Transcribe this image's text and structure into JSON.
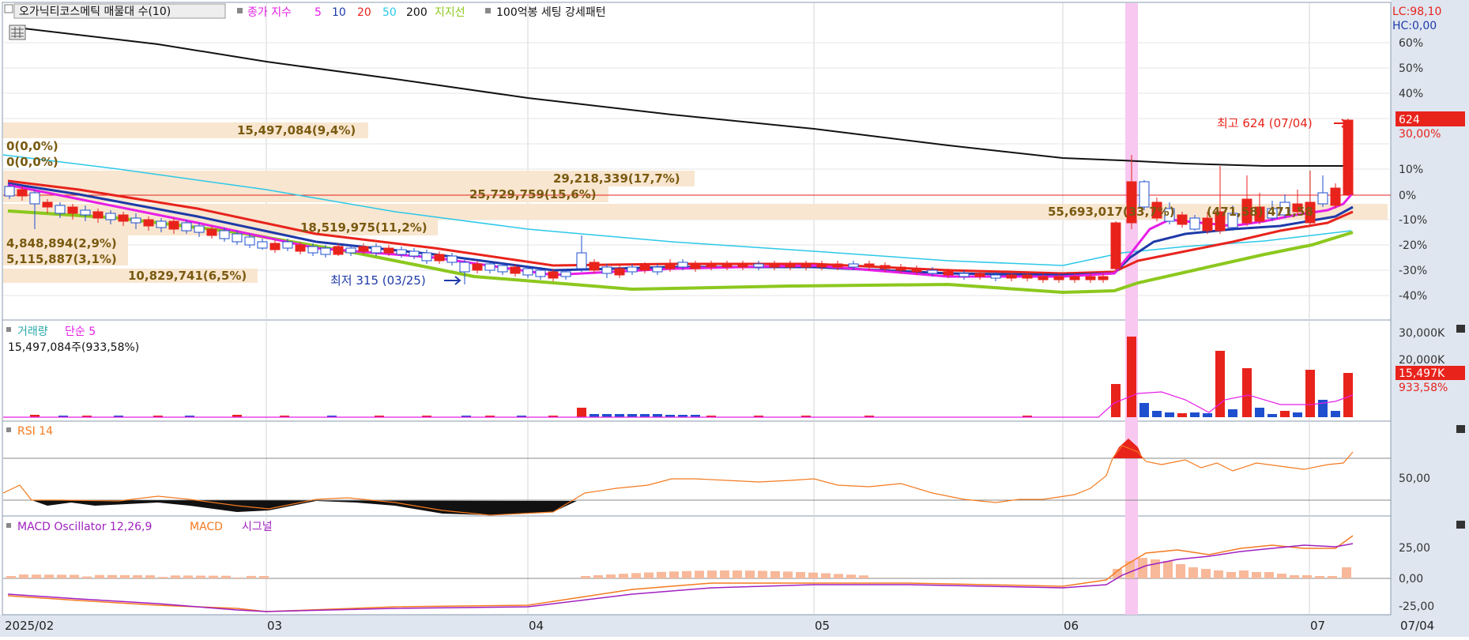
{
  "legend": {
    "title": "오가닉티코스메틱 매물대 수(10)",
    "close_ma": "종가 지수",
    "periods": [
      "5",
      "10",
      "20",
      "50",
      "200"
    ],
    "support": "지지선",
    "pattern": "100억봉 세팅 강세패턴"
  },
  "scale_info": {
    "lc": "LC:98,10",
    "hc": "HC:0,00"
  },
  "colors": {
    "bg": "#ffffff",
    "panel_right": "#dfe6f0",
    "border": "#8a9aae",
    "up": "#e8231c",
    "down": "#1e4fcf",
    "ma5": "#e61ee6",
    "ma10": "#1e3aa8",
    "ma20": "#e8231c",
    "ma50": "#2cc8e8",
    "ma200": "#111111",
    "support": "#8cc81e",
    "vp": "#f8e6d0",
    "vp_text": "#7a5a10",
    "rsi": "#f47a20",
    "macd": "#f47a20",
    "signal": "#a020c0",
    "osc": "#f8b89a",
    "highlight": "#f8c8f0"
  },
  "price_panel": {
    "axis_ticks": [
      "60%",
      "50%",
      "40%",
      "30,00%",
      "20%",
      "10%",
      "0%",
      "-10%",
      "-20%",
      "-30%",
      "-40%"
    ],
    "current_badge": "624",
    "current_pct": "30,00%",
    "high_label": "최고 624 (07/04)",
    "low_label": "최저 315 (03/25)",
    "volume_profile": [
      {
        "label": "15,497,084(9,4%)"
      },
      {
        "label": "0(0,0%)"
      },
      {
        "label": "0(0,0%)"
      },
      {
        "label": "29,218,339(17,7%)"
      },
      {
        "label": "25,729,759(15,6%)"
      },
      {
        "label": "55,693,017(33,7%)"
      },
      {
        "label": "18,519,975(11,2%)"
      },
      {
        "label": "4,848,894(2,9%)"
      },
      {
        "label": "5,115,887(3,1%)"
      },
      {
        "label": "10,829,741(6,5%)"
      }
    ],
    "overlay_label": "(471,58)",
    "overlay_label2": "471,58"
  },
  "volume_panel": {
    "title": "거래량",
    "ma_label": "단순 5",
    "value_text": "15,497,084주(933,58%)",
    "axis_ticks": [
      "30,000K",
      "20,000K"
    ],
    "badge": "15,497K",
    "badge_pct": "933,58%"
  },
  "rsi_panel": {
    "title": "RSI 14",
    "axis_tick": "50,00"
  },
  "macd_panel": {
    "title": "MACD Oscillator 12,26,9",
    "macd_label": "MACD",
    "signal_label": "시그널",
    "axis_ticks": [
      "25,00",
      "0,00",
      "-25,00"
    ]
  },
  "x_axis": {
    "labels": [
      "2025/02",
      "03",
      "04",
      "05",
      "06",
      "07"
    ],
    "last_date": "07/04"
  },
  "chart_data": [
    {
      "type": "line",
      "title": "오가닉티코스메틱 매물대 수(10)",
      "x": [
        "2025/02",
        "03",
        "04",
        "05",
        "06",
        "07"
      ],
      "ylim": [
        -40,
        60
      ],
      "y_unit": "%",
      "series": [
        {
          "name": "5",
          "values": [
            0,
            -20,
            -30,
            -31,
            -30,
            5
          ]
        },
        {
          "name": "200",
          "values": [
            65,
            50,
            33,
            23,
            14,
            12
          ]
        }
      ],
      "annotations": {
        "high": 624,
        "high_date": "07/04",
        "low": 315,
        "low_date": "03/25"
      },
      "volume_profile": [
        15497084,
        0,
        0,
        29218339,
        25729759,
        55693017,
        18519975,
        4848894,
        5115887,
        10829741
      ]
    },
    {
      "type": "bar",
      "title": "거래량",
      "categories": [
        "2025/02",
        "03",
        "04",
        "05",
        "06",
        "07"
      ],
      "values": [
        400,
        300,
        900,
        200,
        29000,
        15497
      ],
      "ylim": [
        0,
        30000
      ]
    },
    {
      "type": "line",
      "title": "RSI 14",
      "ylim": [
        0,
        100
      ],
      "series": [
        {
          "name": "RSI 14",
          "values": [
            35,
            33,
            48,
            52,
            38,
            72
          ]
        }
      ]
    },
    {
      "type": "line",
      "title": "MACD Oscillator 12,26,9",
      "ylim": [
        -35,
        45
      ],
      "series": [
        {
          "name": "MACD",
          "values": [
            -18,
            -30,
            -25,
            -5,
            -10,
            38
          ]
        },
        {
          "name": "시그널",
          "values": [
            -16,
            -28,
            -27,
            -8,
            -12,
            28
          ]
        }
      ]
    }
  ]
}
